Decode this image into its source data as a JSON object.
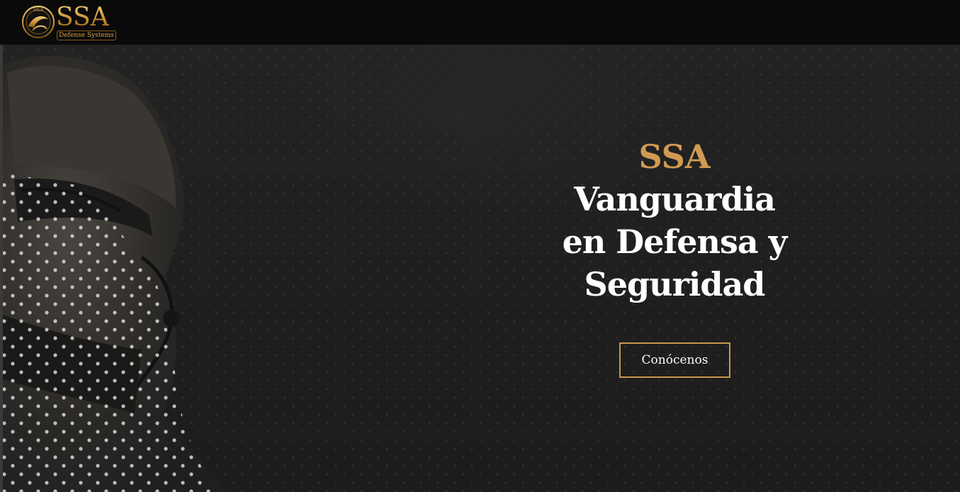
{
  "header": {
    "logo_mark": "SSA",
    "logo_subtitle": "Defense Systems",
    "emblem_text": "SSA"
  },
  "hero": {
    "brand": "SSA",
    "headline_lines": [
      "Vanguardia",
      "en Defensa y",
      "Seguridad"
    ],
    "cta_label": "Conócenos"
  },
  "colors": {
    "accent_gold": "#d19a52",
    "button_border": "#c9974c",
    "topbar_bg": "#0a0a0a",
    "hero_bg": "#1f1f1f"
  }
}
